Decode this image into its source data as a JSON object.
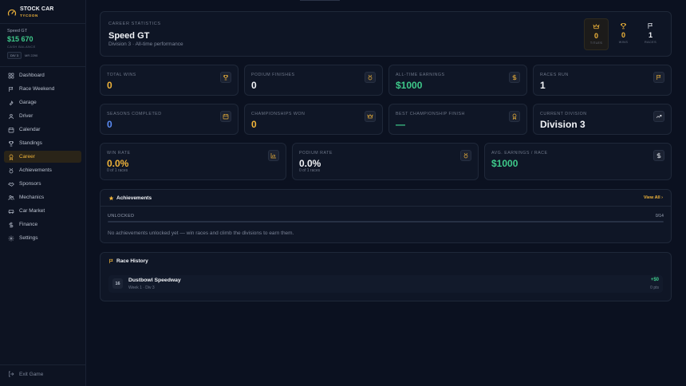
{
  "app": {
    "title": "STOCK CAR",
    "subtitle": "TYCOON"
  },
  "team": {
    "car": "Speed GT",
    "cash": "$15 670",
    "cash_label": "CASH BALANCE",
    "division_tag": "DIV 3",
    "mr": "MR 2290"
  },
  "nav": [
    {
      "label": "Dashboard",
      "icon": "dashboard-icon"
    },
    {
      "label": "Race Weekend",
      "icon": "flag-icon"
    },
    {
      "label": "Garage",
      "icon": "wrench-icon"
    },
    {
      "label": "Driver",
      "icon": "user-icon"
    },
    {
      "label": "Calendar",
      "icon": "calendar-icon"
    },
    {
      "label": "Standings",
      "icon": "trophy-icon"
    },
    {
      "label": "Career",
      "icon": "award-icon",
      "active": true
    },
    {
      "label": "Achievements",
      "icon": "medal-icon"
    },
    {
      "label": "Sponsors",
      "icon": "handshake-icon"
    },
    {
      "label": "Mechanics",
      "icon": "users-icon"
    },
    {
      "label": "Car Market",
      "icon": "car-icon"
    },
    {
      "label": "Finance",
      "icon": "dollar-icon"
    },
    {
      "label": "Settings",
      "icon": "gear-icon"
    }
  ],
  "exit_label": "Exit Game",
  "hero": {
    "label": "CAREER STATISTICS",
    "title": "Speed GT",
    "subtitle": "Division 3 · All-time performance",
    "stats": [
      {
        "value": "0",
        "label": "TITLES",
        "icon": "crown-icon"
      },
      {
        "value": "0",
        "label": "WINS",
        "icon": "trophy-icon"
      },
      {
        "value": "1",
        "label": "RACES",
        "icon": "flag-icon"
      }
    ]
  },
  "stats_row1": [
    {
      "label": "TOTAL WINS",
      "value": "0",
      "icon": "trophy-icon"
    },
    {
      "label": "PODIUM FINISHES",
      "value": "0",
      "icon": "medal-icon"
    },
    {
      "label": "ALL-TIME EARNINGS",
      "value": "$1000",
      "icon": "dollar-icon"
    },
    {
      "label": "RACES RUN",
      "value": "1",
      "icon": "flag-icon"
    }
  ],
  "stats_row2": [
    {
      "label": "SEASONS COMPLETED",
      "value": "0",
      "icon": "calendar-icon"
    },
    {
      "label": "CHAMPIONSHIPS WON",
      "value": "0",
      "icon": "crown-icon"
    },
    {
      "label": "BEST CHAMPIONSHIP FINISH",
      "value": "—",
      "icon": "award-icon"
    },
    {
      "label": "CURRENT DIVISION",
      "value": "Division 3",
      "icon": "trend-up-icon"
    }
  ],
  "stats_row3": [
    {
      "label": "WIN RATE",
      "value": "0.0%",
      "foot": "0 of 1 races",
      "icon": "bar-chart-icon"
    },
    {
      "label": "PODIUM RATE",
      "value": "0.0%",
      "foot": "0 of 1 races",
      "icon": "medal-icon"
    },
    {
      "label": "AVG. EARNINGS / RACE",
      "value": "$1000",
      "icon": "dollar-icon"
    }
  ],
  "achievements": {
    "title": "Achievements",
    "view_all": "View All",
    "unlocked_label": "UNLOCKED",
    "count": "0/14",
    "progress": 0,
    "empty": "No achievements unlocked yet — win races and climb the divisions to earn them."
  },
  "race_history": {
    "title": "Race History",
    "races": [
      {
        "position": "16",
        "track": "Dustbowl Speedway",
        "meta": "Week 1 · Div 3",
        "prize": "+$0",
        "points": "0 pts"
      }
    ]
  },
  "colors": {
    "accent": "#f0b43a",
    "blue": "#5b8cf6",
    "green": "#3ec98a",
    "bg": "#0b1120"
  }
}
